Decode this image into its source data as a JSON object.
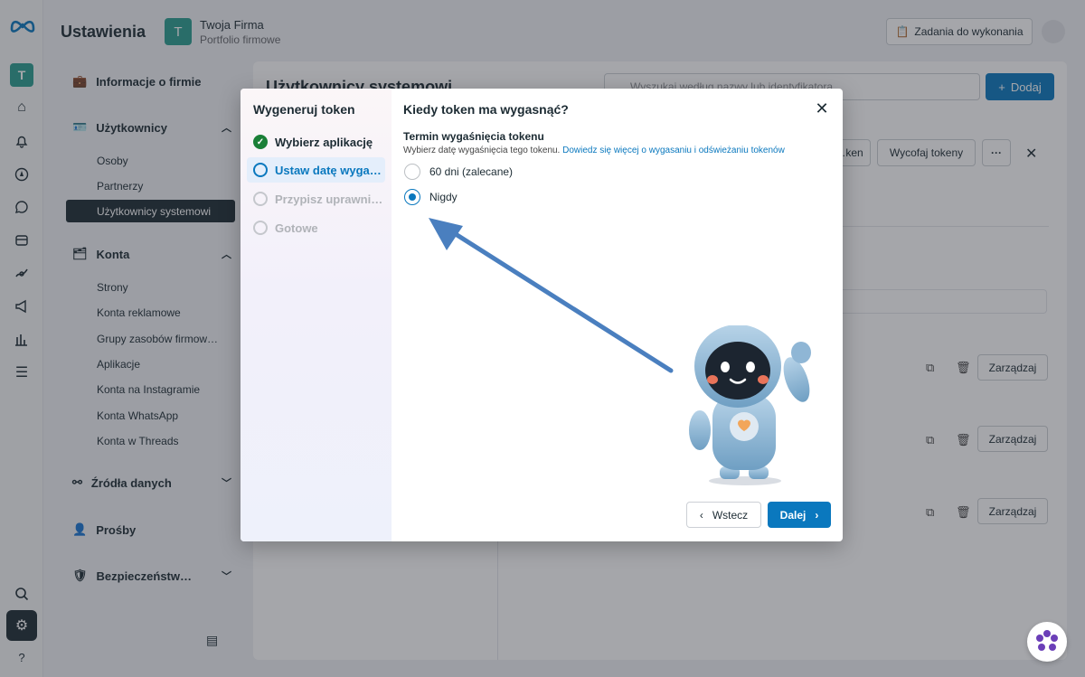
{
  "app": {
    "title": "Ustawienia",
    "business_initial": "T",
    "business_name": "Twoja Firma",
    "business_sub": "Portfolio firmowe",
    "tasks_label": "Zadania do wykonania"
  },
  "rail": {
    "avatar_initial": "T",
    "help_label": "?"
  },
  "sidebar": {
    "company_info": "Informacje o firmie",
    "users_header": "Użytkownicy",
    "users_items": [
      "Osoby",
      "Partnerzy",
      "Użytkownicy systemowi"
    ],
    "accounts_header": "Konta",
    "accounts_items": [
      "Strony",
      "Konta reklamowe",
      "Grupy zasobów firmow…",
      "Aplikacje",
      "Konta na Instagramie",
      "Konta WhatsApp",
      "Konta w Threads"
    ],
    "data_sources": "Źródła danych",
    "requests": "Prośby",
    "security": "Bezpieczeństw…"
  },
  "content": {
    "title": "Użytkownicy systemowi",
    "search_placeholder": "Wyszukaj według nazwy lub identyfikatora",
    "add_label": "Dodaj",
    "gen_token_label": "…ken",
    "revoke_label": "Wycofaj tokeny",
    "more_label": "···",
    "manage_label": "Zarządzaj"
  },
  "modal": {
    "left_title": "Wygeneruj token",
    "steps": [
      "Wybierz aplikację",
      "Ustaw datę wyga…",
      "Przypisz uprawni…",
      "Gotowe"
    ],
    "question": "Kiedy token ma wygasnąć?",
    "section_label": "Termin wygaśnięcia tokenu",
    "section_hint": "Wybierz datę wygaśnięcia tego tokenu.",
    "section_link": "Dowiedz się więcej o wygasaniu i odświeżaniu tokenów",
    "options": [
      "60 dni (zalecane)",
      "Nigdy"
    ],
    "selected_option": "Nigdy",
    "back_label": "Wstecz",
    "next_label": "Dalej"
  },
  "colors": {
    "accent": "#0a78be",
    "success": "#1a7f37",
    "arrow": "#4a7fbf",
    "brand_teal": "#2a9d8f"
  }
}
